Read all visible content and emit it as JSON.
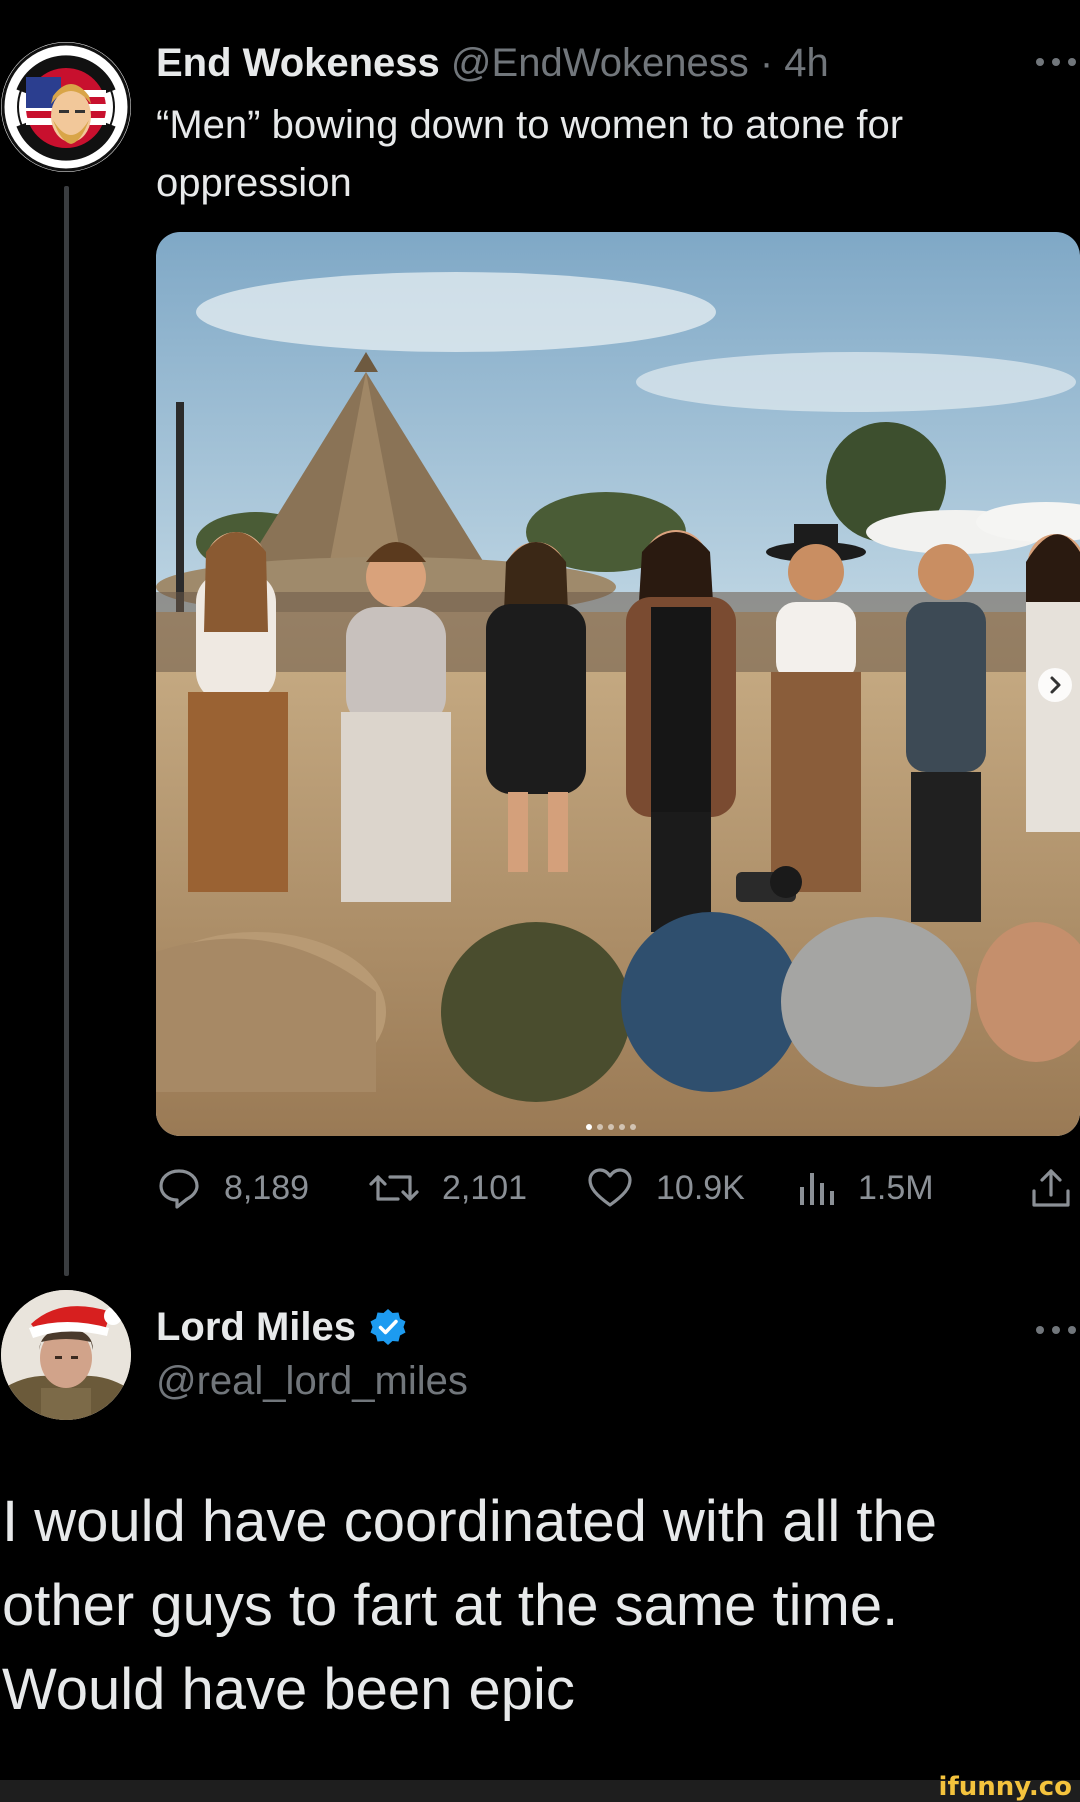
{
  "tweet": {
    "author": {
      "display_name": "End Wokeness",
      "handle": "@EndWokeness",
      "time_separator": "·",
      "time": "4h",
      "avatar_icon": "i-support-the-former-things-badge"
    },
    "text": "“Men” bowing down to women to atone for oppression",
    "media": {
      "description_icon": "photo-men-kneeling-before-women",
      "carousel_dots": 5,
      "active_dot": 0
    },
    "stats": {
      "replies": "8,189",
      "retweets": "2,101",
      "likes": "10.9K",
      "views": "1.5M"
    }
  },
  "reply": {
    "author": {
      "display_name": "Lord Miles",
      "handle": "@real_lord_miles",
      "verified": true
    },
    "text": "I would have coordinated with all the other guys to fart at the same time. Would have been epic"
  },
  "watermark": "ifunny.co",
  "colors": {
    "background": "#000000",
    "text_primary": "#e7e9ea",
    "text_secondary": "#71767b",
    "verified_blue": "#1d9bf0",
    "watermark_yellow": "#f4c33d"
  }
}
